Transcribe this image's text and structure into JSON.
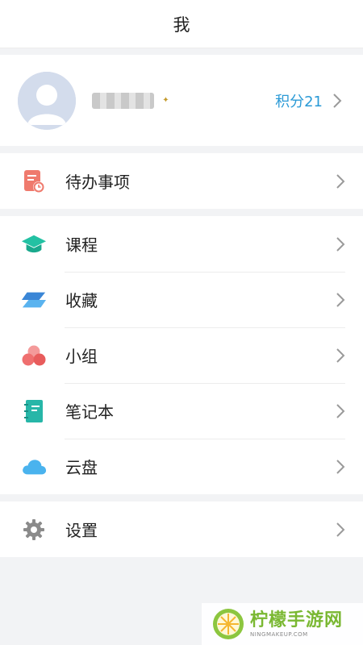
{
  "header": {
    "title": "我"
  },
  "profile": {
    "username": "█████",
    "points_label": "积分21",
    "avatar_icon": "avatar-placeholder-icon"
  },
  "menu": {
    "todo": {
      "label": "待办事项",
      "icon": "todo-clock-icon",
      "color": "#ef7a6d"
    },
    "courses": {
      "label": "课程",
      "icon": "graduation-cap-icon",
      "color": "#23c1a3"
    },
    "favorites": {
      "label": "收藏",
      "icon": "layers-icon",
      "color": "#3a86d6"
    },
    "groups": {
      "label": "小组",
      "icon": "group-circles-icon",
      "color": "#ef6f6f"
    },
    "notebook": {
      "label": "笔记本",
      "icon": "notebook-icon",
      "color": "#27b6a8"
    },
    "cloud": {
      "label": "云盘",
      "icon": "cloud-icon",
      "color": "#4ab3ee"
    },
    "settings": {
      "label": "设置",
      "icon": "gear-icon",
      "color": "#8b8b8b"
    }
  },
  "watermark": {
    "title": "柠檬手游网",
    "subtitle": "NINGMAKEUP.COM"
  },
  "colors": {
    "accent": "#2a9ad6",
    "background": "#f2f3f5",
    "chevron": "#9a9a9a"
  }
}
